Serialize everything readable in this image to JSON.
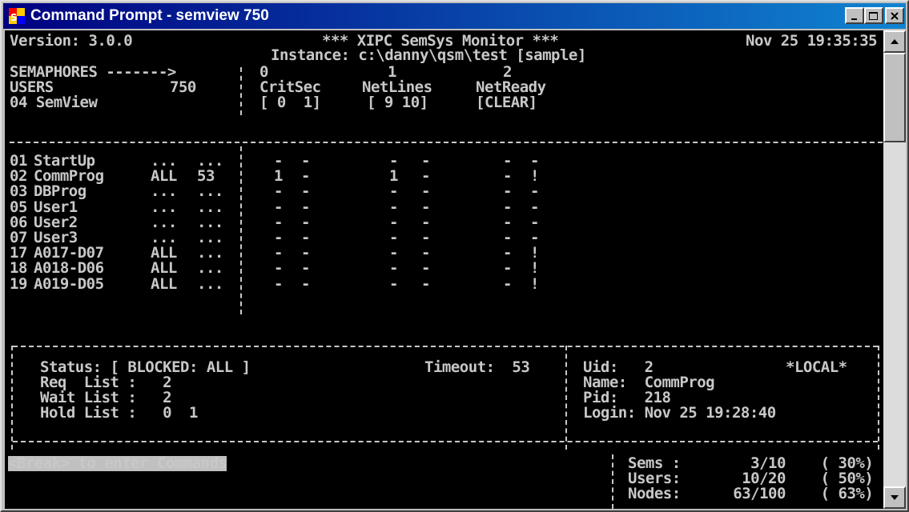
{
  "window": {
    "title": "Command Prompt - semview 750",
    "buttons": {
      "minimize": "minimize-icon",
      "maximize": "maximize-icon",
      "close": "close-icon"
    }
  },
  "header": {
    "version": "Version: 3.0.0",
    "monitor_title": "*** XIPC SemSys Monitor ***",
    "datetime": "Nov 25 19:35:35",
    "instance": "Instance: c:\\danny\\qsm\\test [sample]"
  },
  "semaphores": {
    "label": "SEMAPHORES ------->",
    "users_label": "USERS",
    "users_count": "750",
    "semview": "04 SemView",
    "columns": [
      {
        "id": "0",
        "name": "CritSec",
        "value": "[ 0  1]"
      },
      {
        "id": "1",
        "name": "NetLines",
        "value": "[ 9 10]"
      },
      {
        "id": "2",
        "name": "NetReady",
        "value": "[CLEAR]"
      }
    ]
  },
  "users": [
    {
      "num": "01",
      "name": "StartUp",
      "scope": "...",
      "count": "...",
      "c0a": "-",
      "c0b": "-",
      "c1a": "-",
      "c1b": "-",
      "c2a": "-",
      "c2b": "-"
    },
    {
      "num": "02",
      "name": "CommProg",
      "scope": "ALL",
      "count": "53",
      "c0a": "1",
      "c0b": "-",
      "c1a": "1",
      "c1b": "-",
      "c2a": "-",
      "c2b": "!"
    },
    {
      "num": "03",
      "name": "DBProg",
      "scope": "...",
      "count": "...",
      "c0a": "-",
      "c0b": "-",
      "c1a": "-",
      "c1b": "-",
      "c2a": "-",
      "c2b": "-"
    },
    {
      "num": "05",
      "name": "User1",
      "scope": "...",
      "count": "...",
      "c0a": "-",
      "c0b": "-",
      "c1a": "-",
      "c1b": "-",
      "c2a": "-",
      "c2b": "-"
    },
    {
      "num": "06",
      "name": "User2",
      "scope": "...",
      "count": "...",
      "c0a": "-",
      "c0b": "-",
      "c1a": "-",
      "c1b": "-",
      "c2a": "-",
      "c2b": "-"
    },
    {
      "num": "07",
      "name": "User3",
      "scope": "...",
      "count": "...",
      "c0a": "-",
      "c0b": "-",
      "c1a": "-",
      "c1b": "-",
      "c2a": "-",
      "c2b": "-"
    },
    {
      "num": "17",
      "name": "A017-D07",
      "scope": "ALL",
      "count": "...",
      "c0a": "-",
      "c0b": "-",
      "c1a": "-",
      "c1b": "-",
      "c2a": "-",
      "c2b": "!"
    },
    {
      "num": "18",
      "name": "A018-D06",
      "scope": "ALL",
      "count": "...",
      "c0a": "-",
      "c0b": "-",
      "c1a": "-",
      "c1b": "-",
      "c2a": "-",
      "c2b": "!"
    },
    {
      "num": "19",
      "name": "A019-D05",
      "scope": "ALL",
      "count": "...",
      "c0a": "-",
      "c0b": "-",
      "c1a": "-",
      "c1b": "-",
      "c2a": "-",
      "c2b": "!"
    }
  ],
  "status": {
    "status_line": "Status: [ BLOCKED: ALL ]",
    "timeout": "Timeout:  53",
    "req_list": "Req  List :   2",
    "wait_list": "Wait List :   2",
    "hold_list": "Hold List :   0  1"
  },
  "user_info": {
    "uid": "Uid:   2",
    "local": "*LOCAL*",
    "name": "Name:  CommProg",
    "pid": "Pid:   218",
    "login": "Login: Nov 25 19:28:40"
  },
  "footer": {
    "prompt": "<Break> to enter Commands",
    "sems": "Sems :        3/10    ( 30%)",
    "users": "Users:       10/20    ( 50%)",
    "nodes": "Nodes:      63/100    ( 63%)"
  }
}
